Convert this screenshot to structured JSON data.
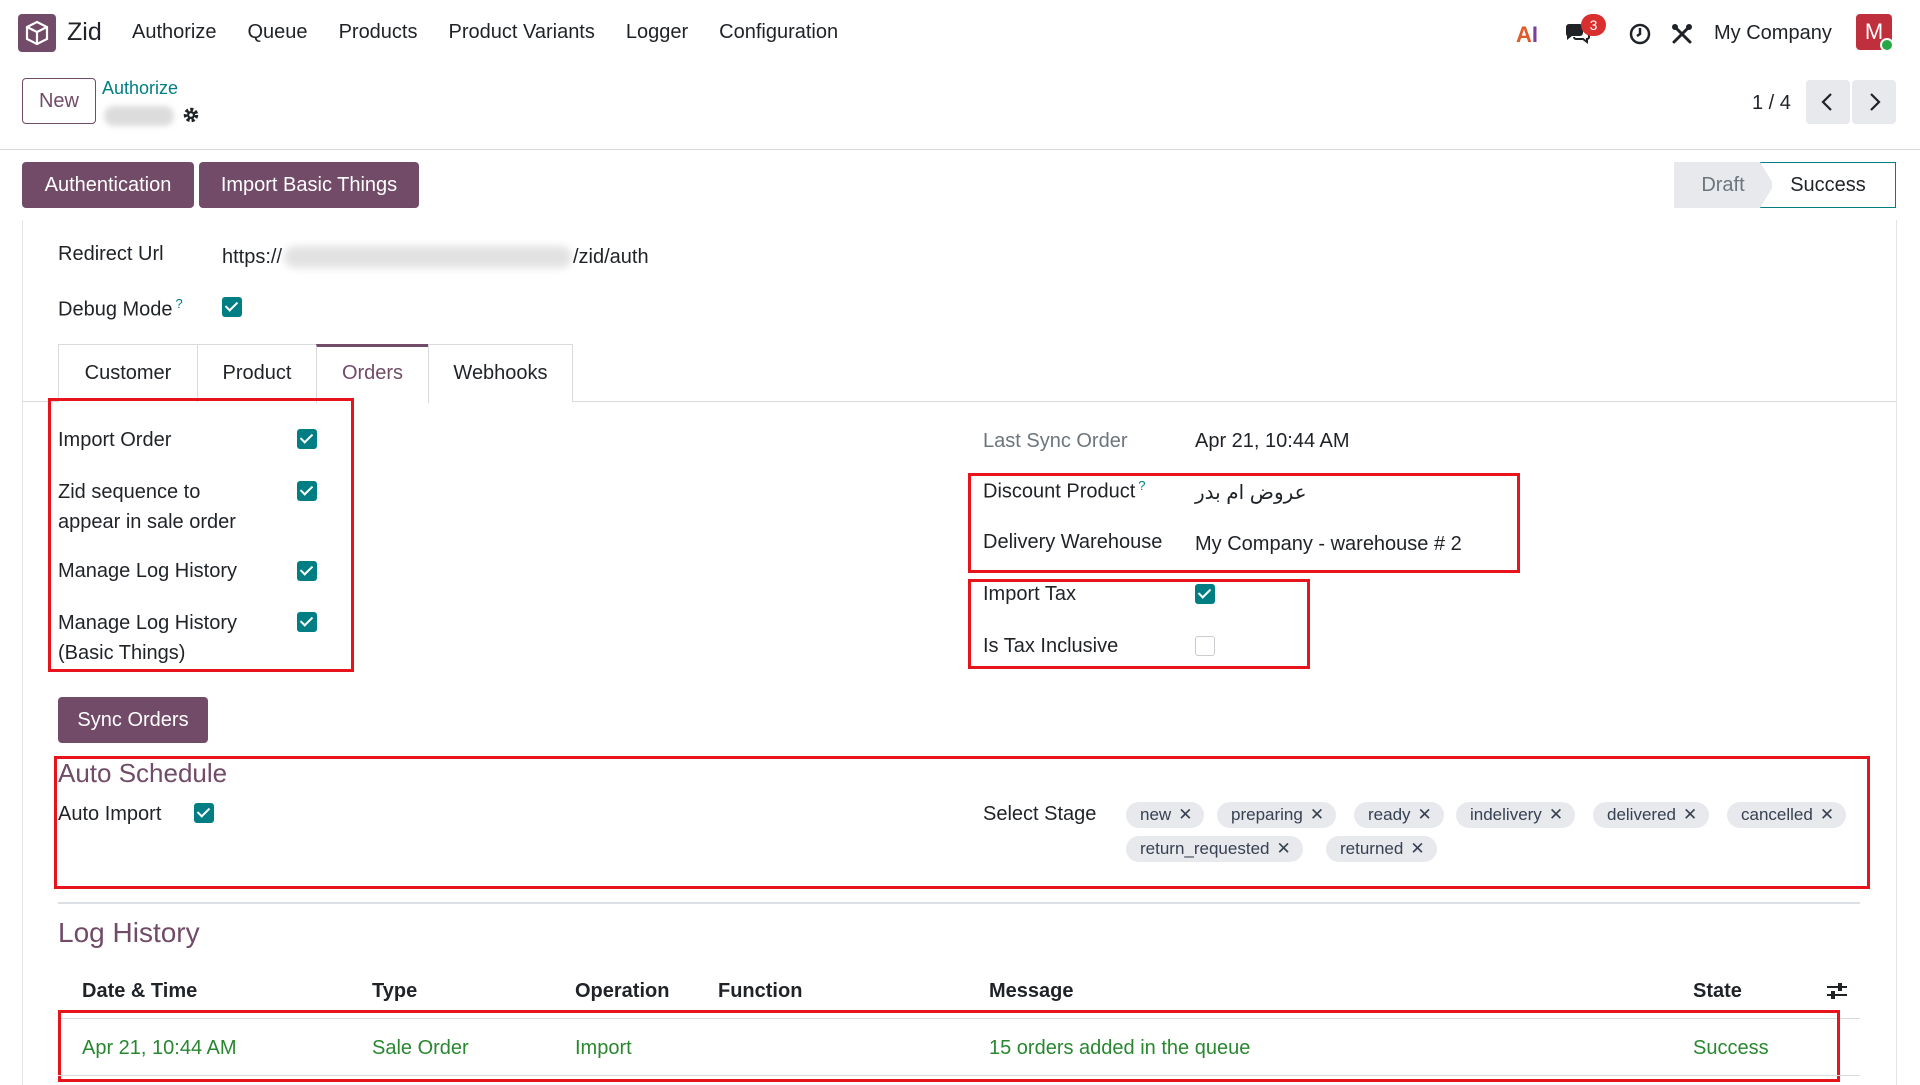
{
  "navbar": {
    "app_name": "Zid",
    "menu": [
      "Authorize",
      "Queue",
      "Products",
      "Product Variants",
      "Logger",
      "Configuration"
    ],
    "chat_badge": "3",
    "company": "My Company",
    "avatar_letter": "M",
    "ai_a": "A",
    "ai_i": "I"
  },
  "control": {
    "new_label": "New",
    "breadcrumb": "Authorize",
    "pager": "1 / 4"
  },
  "header": {
    "auth_button": "Authentication",
    "import_button": "Import Basic Things",
    "status": [
      "Draft",
      "Success"
    ],
    "current_status": "Success"
  },
  "form": {
    "redirect_url_label": "Redirect Url",
    "redirect_url_prefix": "https://",
    "redirect_url_suffix": "/zid/auth",
    "debug_mode_label": "Debug Mode",
    "debug_mode": true,
    "help_mark": "?"
  },
  "tabs": [
    "Customer",
    "Product",
    "Orders",
    "Webhooks"
  ],
  "active_tab": "Orders",
  "orders": {
    "import_order_label": "Import Order",
    "import_order": true,
    "zid_sequence_label_1": "Zid sequence to",
    "zid_sequence_label_2": "appear in sale order",
    "zid_sequence": true,
    "manage_log_label": "Manage Log History",
    "manage_log": true,
    "manage_log_basic_label_1": "Manage Log History",
    "manage_log_basic_label_2": "(Basic Things)",
    "manage_log_basic": true,
    "last_sync_label": "Last Sync Order",
    "last_sync_value": "Apr 21, 10:44 AM",
    "discount_product_label": "Discount Product",
    "discount_product_value": "عروض ام بدر",
    "delivery_warehouse_label": "Delivery Warehouse",
    "delivery_warehouse_value": "My Company - warehouse # 2",
    "import_tax_label": "Import Tax",
    "import_tax": true,
    "tax_inclusive_label": "Is Tax Inclusive",
    "tax_inclusive": false,
    "sync_button": "Sync Orders"
  },
  "auto_schedule": {
    "title": "Auto Schedule",
    "auto_import_label": "Auto Import",
    "auto_import": true,
    "select_stage_label": "Select Stage",
    "stages": [
      "new",
      "preparing",
      "ready",
      "indelivery",
      "delivered",
      "cancelled",
      "return_requested",
      "returned"
    ],
    "remove_glyph": "✕"
  },
  "log_history": {
    "title": "Log History",
    "columns": [
      "Date & Time",
      "Type",
      "Operation",
      "Function",
      "Message",
      "State"
    ],
    "rows": [
      {
        "datetime": "Apr 21, 10:44 AM",
        "type": "Sale Order",
        "operation": "Import",
        "function": "",
        "message": "15 orders added in the queue",
        "state": "Success"
      }
    ],
    "row_color": "#28872f"
  },
  "colors": {
    "primary": "#714b67",
    "accent": "#017e84",
    "highlight_border": "#e8141c"
  }
}
